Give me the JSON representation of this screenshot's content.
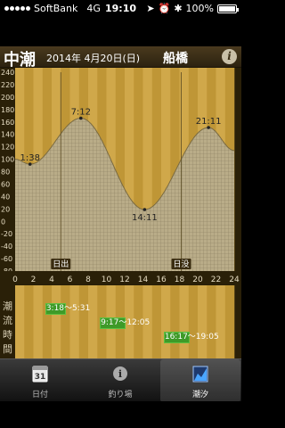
{
  "status": {
    "carrier": "SoftBank",
    "network": "4G",
    "time": "19:10",
    "battery": "100%",
    "battery_level": 1.0
  },
  "header": {
    "title": "中潮",
    "date": "2014年 4月20日(日)",
    "place": "船橋",
    "info_icon": "i"
  },
  "chart_data": {
    "type": "area",
    "ylim": [
      -80,
      240
    ],
    "yticks": [
      -80,
      -60,
      -40,
      -20,
      0,
      20,
      40,
      60,
      80,
      100,
      120,
      140,
      160,
      180,
      200,
      220,
      240
    ],
    "xlim": [
      0,
      24
    ],
    "xticks": [
      0,
      2,
      4,
      6,
      8,
      10,
      12,
      14,
      16,
      18,
      20,
      22,
      24
    ],
    "tide_points": [
      {
        "t": 0,
        "h": 100
      },
      {
        "t": 1.633,
        "h": 92
      },
      {
        "t": 7.2,
        "h": 166
      },
      {
        "t": 14.183,
        "h": 19
      },
      {
        "t": 21.183,
        "h": 151
      },
      {
        "t": 24,
        "h": 114
      }
    ],
    "annotations": [
      {
        "label": "1:38",
        "t": 1.633,
        "h": 92
      },
      {
        "label": "7:12",
        "t": 7.2,
        "h": 166
      },
      {
        "label": "14:11",
        "t": 14.183,
        "h": 19
      },
      {
        "label": "21:11",
        "t": 21.183,
        "h": 151
      }
    ],
    "sunrise": {
      "label": "日出",
      "t": 5.0
    },
    "sunset": {
      "label": "日没",
      "t": 18.2
    }
  },
  "flow": {
    "label_chars": [
      "潮",
      "流",
      "時",
      "間"
    ],
    "periods": [
      {
        "label": "3:18〜5:31",
        "start": 3.3,
        "end": 5.52
      },
      {
        "label": "9:17〜12:05",
        "start": 9.28,
        "end": 12.08
      },
      {
        "label": "16:17〜19:05",
        "start": 16.28,
        "end": 19.08
      }
    ]
  },
  "tabs": [
    {
      "label": "日付",
      "icon": "calendar-icon",
      "icon_text": "31"
    },
    {
      "label": "釣り場",
      "icon": "info-icon",
      "icon_text": "i"
    },
    {
      "label": "潮汐",
      "icon": "tide-chart-icon",
      "active": true
    }
  ],
  "colors": {
    "stripe_light": "#d0a84a",
    "stripe_dark": "#bf9636",
    "fill": "#b8ab86",
    "accent_green": "#3e9a28"
  }
}
